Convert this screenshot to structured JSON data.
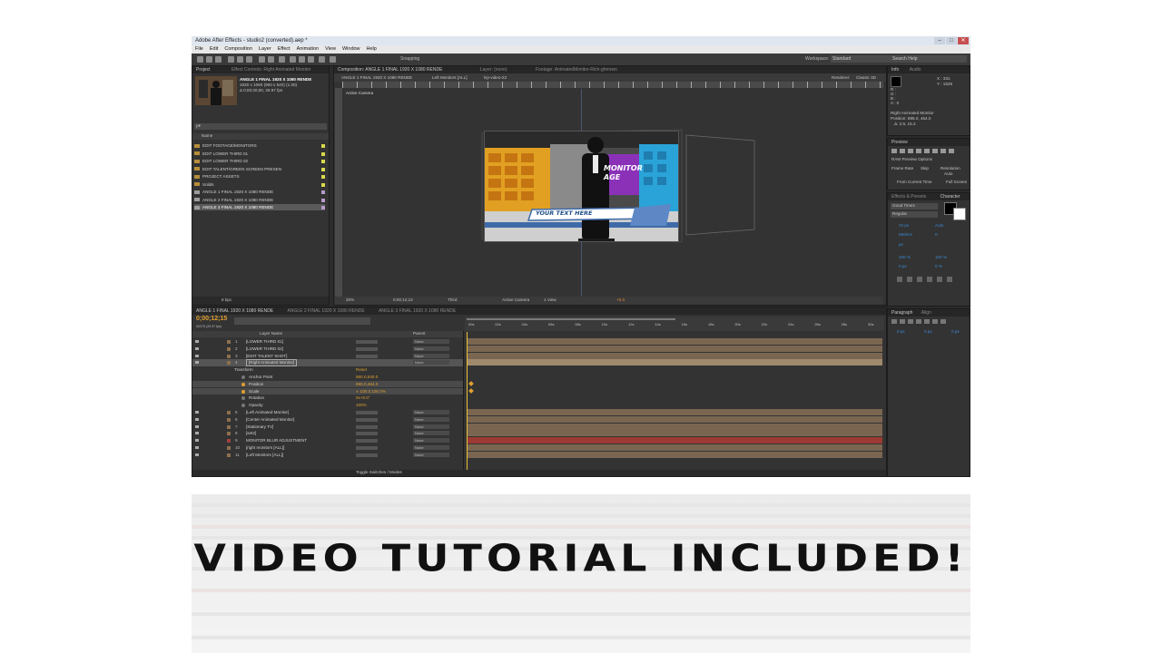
{
  "app": {
    "title": "Adobe After Effects - studio2 (converted).aep *",
    "menu": [
      "File",
      "Edit",
      "Composition",
      "Layer",
      "Effect",
      "Animation",
      "View",
      "Window",
      "Help"
    ],
    "toolbar": {
      "snapping": "Snapping",
      "workspace_label": "Workspace:",
      "workspace_value": "Standard",
      "search": "Search Help"
    }
  },
  "project": {
    "tab": "Project",
    "tab2": "Effect Controls: Right Animated Monitor",
    "selected_name": "ANGLE 1 FINAL 1920 X 1080 RENDE",
    "selected_info1": "1920 x 1080 (960 x 540) (1.00)",
    "selected_info2": "Δ 0;00;30;00, 29.97 fps",
    "search_placeholder": "ρ▾",
    "col_name": "Name",
    "items": [
      {
        "label": "EDIT FOOTAGE/MONITORS",
        "folder": true,
        "color": "#d9d94c"
      },
      {
        "label": "EDIT LOWER THIRD 01",
        "folder": true,
        "color": "#d9d94c"
      },
      {
        "label": "EDIT LOWER THIRD 02",
        "folder": true,
        "color": "#d9d94c"
      },
      {
        "label": "EDIT TALENT/GREEN SCREEN PRESEN",
        "folder": true,
        "color": "#d9d94c"
      },
      {
        "label": "PROJECT ASSETS",
        "folder": true,
        "color": "#d9d94c"
      },
      {
        "label": "Solids",
        "folder": true,
        "color": "#d9d94c"
      },
      {
        "label": "ANGLE 1 FINAL 1920 X 1080 RENDE",
        "folder": false,
        "color": "#b79bc9"
      },
      {
        "label": "ANGLE 2 FINAL 1920 X 1080 RENDE",
        "folder": false,
        "color": "#b79bc9"
      },
      {
        "label": "ANGLE 3 FINAL 1920 X 1080 RENDE",
        "folder": false,
        "color": "#b79bc9",
        "selected": true
      }
    ],
    "bpc": "8 bpc"
  },
  "composition": {
    "tab": "Composition: ANGLE 1 FINAL 1920 X 1080 RENDE",
    "tab_layer": "Layer: (none)",
    "tab_footage": "Footage: AnimatedMonitor-Rich-ghmrwn",
    "breadcrumbs": [
      "ANGLE 1 FINAL 1920 X 1080 RENDE",
      "Left Monitors [ALL]",
      "lvp-video-22"
    ],
    "renderer_label": "Renderer:",
    "renderer_value": "Classic 3D",
    "active_camera": "Active Camera",
    "zoom": "20%",
    "timecode": "0;00;12;13",
    "resolution": "Third",
    "camera": "Active Camera",
    "views": "1 View",
    "exposure": "+0.0",
    "monitor_title1": "MONITOR",
    "monitor_title2": "AGE",
    "lower_third": "YOUR TEXT HERE"
  },
  "info": {
    "tab": "Info",
    "tab2": "Audio",
    "x": "X : 331",
    "y": "Y : 1529",
    "r": "R :",
    "g": "G :",
    "b": "B :",
    "a": "A : 0",
    "layer": "Right Animated Monitor",
    "position": "Position: 895.0, 464.0",
    "delta": "Δ: 2.6, 15.2"
  },
  "preview": {
    "tab": "Preview",
    "ram": "RAM Preview Options",
    "frame_rate": "Frame Rate",
    "skip": "Skip",
    "resolution": "Resolution",
    "auto": "Auto",
    "from_current": "From Current Time",
    "full_screen": "Full Screen"
  },
  "character": {
    "tab1": "Effects & Presets",
    "tab2": "Character",
    "font": "Good Times",
    "style": "Regular",
    "size": "72 px",
    "leading": "Auto",
    "kerning": "Metrics",
    "tracking": "0",
    "stroke": "px",
    "vscale": "100 %",
    "hscale": "100 %",
    "baseline": "0 px",
    "tsume": "0 %"
  },
  "paragraph": {
    "tab": "Paragraph",
    "tab2": "Align",
    "indent1": "0 px",
    "indent2": "0 px",
    "indent3": "0 px"
  },
  "timeline": {
    "tab1": "ANGLE 1 FINAL 1920 X 1080 RENDE",
    "tab2": "ANGLE 2 FINAL 1920 X 1080 RENDE",
    "tab3": "ANGLE 3 FINAL 1920 X 1080 RENDE",
    "timecode": "0;00;12;15",
    "frame_info": "00375 (29.97 fps)",
    "col_layer": "Layer Name",
    "col_parent": "Parent",
    "toggle": "Toggle Switches / Modes",
    "ticks": [
      "00s",
      "02s",
      "04s",
      "06s",
      "08s",
      "10s",
      "12s",
      "14s",
      "16s",
      "18s",
      "20s",
      "22s",
      "24s",
      "26s",
      "28s",
      "30s"
    ],
    "layers": [
      {
        "num": "1",
        "name": "[LOWER THIRD 01]",
        "color": "#8c6f4f",
        "parent": "None"
      },
      {
        "num": "2",
        "name": "[LOWER THIRD 02]",
        "color": "#8c6f4f",
        "parent": "None"
      },
      {
        "num": "3",
        "name": "[EDIT TALENT SHOT]",
        "color": "#8c6f4f",
        "parent": "None"
      },
      {
        "num": "4",
        "name": "[Right Animated Monitor]",
        "color": "#8c6f4f",
        "parent": "None",
        "selected": true
      }
    ],
    "transform": "Transform",
    "reset": "Reset",
    "props": [
      {
        "name": "Anchor Point",
        "value": "960.0,540.0"
      },
      {
        "name": "Position",
        "value": "895.0,464.0"
      },
      {
        "name": "Scale",
        "value": "∞ 100.0,100.0%"
      },
      {
        "name": "Rotation",
        "value": "0x+0.0°"
      },
      {
        "name": "Opacity",
        "value": "100%"
      }
    ],
    "layers2": [
      {
        "num": "5",
        "name": "[Left Animated Monitor]",
        "color": "#8c6f4f",
        "parent": "None"
      },
      {
        "num": "6",
        "name": "[Center Animated Monitor]",
        "color": "#8c6f4f",
        "parent": "None"
      },
      {
        "num": "7",
        "name": "[Stationary TV]",
        "color": "#8c6f4f",
        "parent": "None"
      },
      {
        "num": "8",
        "name": "[set2]",
        "color": "#8c6f4f",
        "parent": "None"
      },
      {
        "num": "9",
        "name": "MONITOR BLUR ADJUSTMENT",
        "color": "#a34040",
        "parent": "None"
      },
      {
        "num": "10",
        "name": "[right monitors [ALL]]",
        "color": "#8c6f4f",
        "parent": "None"
      },
      {
        "num": "11",
        "name": "[Left Monitors [ALL]]",
        "color": "#8c6f4f",
        "parent": "None"
      }
    ]
  },
  "banner": "VIDEO TUTORIAL INCLUDED!"
}
